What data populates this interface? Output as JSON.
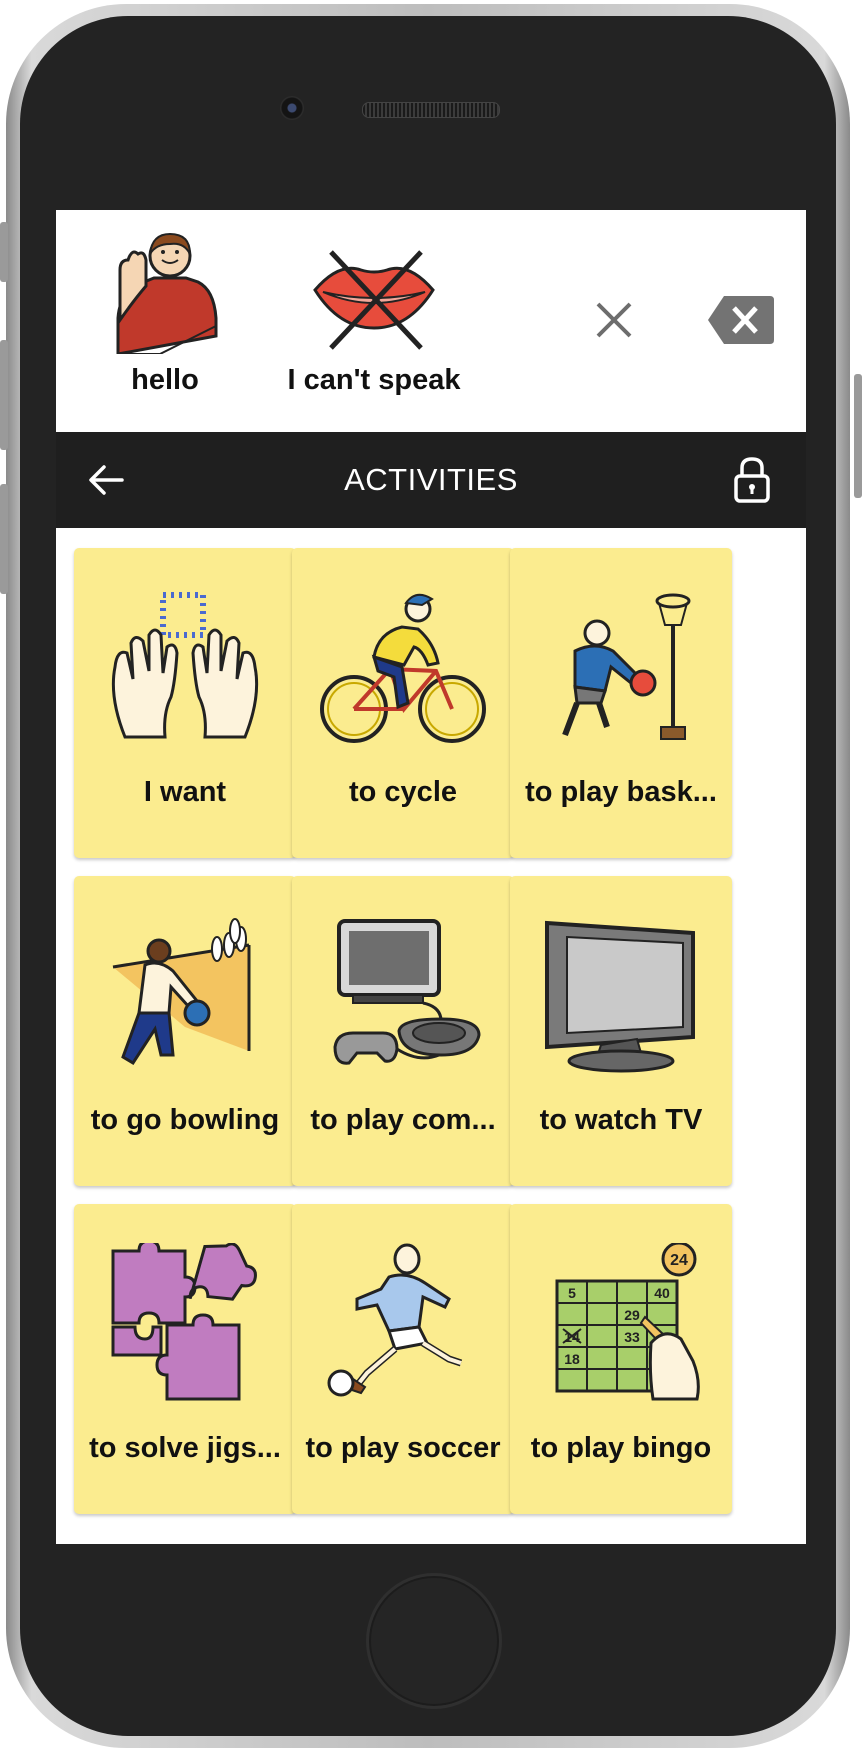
{
  "output_bar": {
    "items": [
      {
        "label": "hello",
        "icon": "waving-person-icon"
      },
      {
        "label": "I can't speak",
        "icon": "crossed-lips-icon"
      }
    ],
    "clear_icon": "close-icon",
    "backspace_icon": "backspace-icon"
  },
  "navbar": {
    "title": "ACTIVITIES",
    "back_icon": "arrow-left-icon",
    "lock_icon": "lock-icon"
  },
  "tiles": [
    {
      "label": "I want",
      "icon": "hands-grab-icon"
    },
    {
      "label": "to cycle",
      "icon": "cyclist-icon"
    },
    {
      "label": "to play bask...",
      "icon": "basketball-player-icon"
    },
    {
      "label": "to go bowling",
      "icon": "bowler-icon"
    },
    {
      "label": "to play com...",
      "icon": "video-game-console-icon"
    },
    {
      "label": "to watch TV",
      "icon": "television-icon"
    },
    {
      "label": "to solve jigs...",
      "icon": "jigsaw-puzzle-icon"
    },
    {
      "label": "to play soccer",
      "icon": "soccer-player-icon"
    },
    {
      "label": "to play bingo",
      "icon": "bingo-card-icon"
    }
  ],
  "bingo_numbers": [
    "24",
    "5",
    "40",
    "29",
    "14",
    "33",
    "18"
  ],
  "colors": {
    "tile_background": "#fbec8f",
    "navbar_background": "#1f1f1f",
    "phone_frame": "#232323"
  }
}
